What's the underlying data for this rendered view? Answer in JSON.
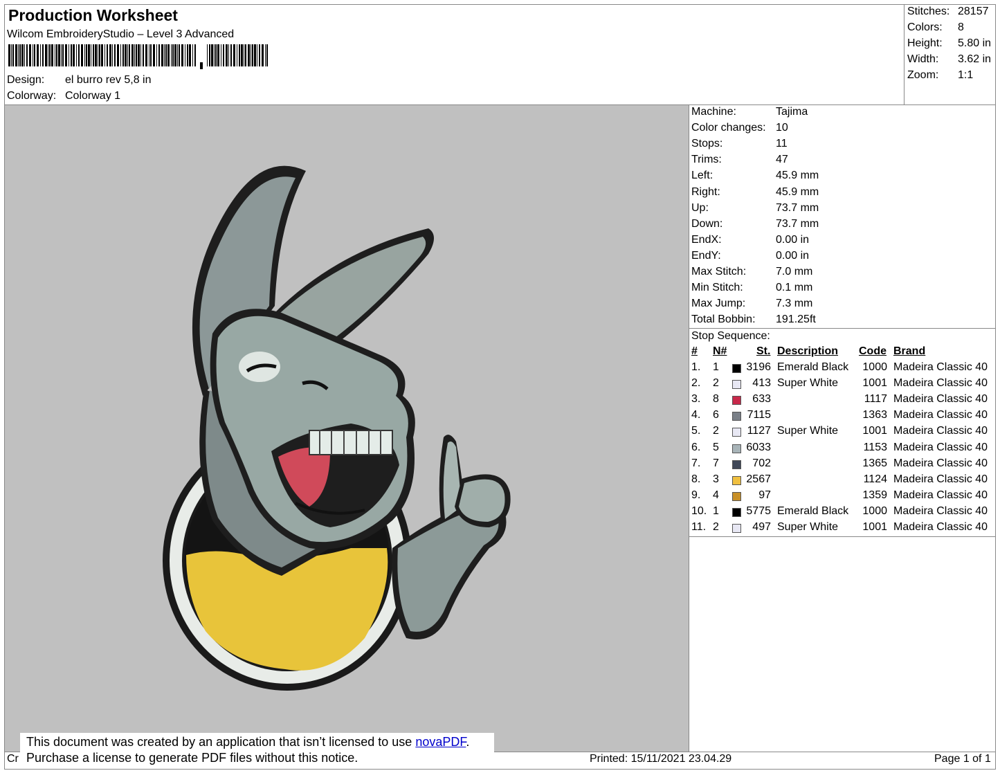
{
  "header": {
    "title": "Production Worksheet",
    "software": "Wilcom EmbroideryStudio – Level 3 Advanced",
    "design_label": "Design:",
    "design_value": "el burro rev 5,8 in",
    "colorway_label": "Colorway:",
    "colorway_value": "Colorway 1"
  },
  "stats": [
    {
      "label": "Stitches:",
      "value": "28157"
    },
    {
      "label": "Colors:",
      "value": "8"
    },
    {
      "label": "Height:",
      "value": "5.80 in"
    },
    {
      "label": "Width:",
      "value": "3.62 in"
    },
    {
      "label": "Zoom:",
      "value": "1:1"
    }
  ],
  "machine_info": [
    {
      "label": "Machine:",
      "value": "Tajima"
    },
    {
      "label": "Color changes:",
      "value": "10"
    },
    {
      "label": "Stops:",
      "value": "11"
    },
    {
      "label": "Trims:",
      "value": "47"
    },
    {
      "label": "Left:",
      "value": "45.9 mm"
    },
    {
      "label": "Right:",
      "value": "45.9 mm"
    },
    {
      "label": "Up:",
      "value": "73.7 mm"
    },
    {
      "label": "Down:",
      "value": "73.7 mm"
    },
    {
      "label": "EndX:",
      "value": "0.00 in"
    },
    {
      "label": "EndY:",
      "value": "0.00 in"
    },
    {
      "label": "Max Stitch:",
      "value": "7.0 mm"
    },
    {
      "label": "Min Stitch:",
      "value": "0.1 mm"
    },
    {
      "label": "Max Jump:",
      "value": "7.3 mm"
    },
    {
      "label": "Total Bobbin:",
      "value": "191.25ft"
    }
  ],
  "stop_sequence": {
    "title": "Stop Sequence:",
    "headers": {
      "num": "#",
      "n": "N#",
      "st": "St.",
      "desc": "Description",
      "code": "Code",
      "brand": "Brand"
    },
    "rows": [
      {
        "num": "1.",
        "n": "1",
        "color": "#000000",
        "st": "3196",
        "desc": "Emerald Black",
        "code": "1000",
        "brand": "Madeira Classic 40"
      },
      {
        "num": "2.",
        "n": "2",
        "color": "#e8e8f4",
        "st": "413",
        "desc": "Super White",
        "code": "1001",
        "brand": "Madeira Classic 40"
      },
      {
        "num": "3.",
        "n": "8",
        "color": "#c8284a",
        "st": "633",
        "desc": "",
        "code": "1117",
        "brand": "Madeira Classic 40"
      },
      {
        "num": "4.",
        "n": "6",
        "color": "#7a8088",
        "st": "7115",
        "desc": "",
        "code": "1363",
        "brand": "Madeira Classic 40"
      },
      {
        "num": "5.",
        "n": "2",
        "color": "#e8e8f4",
        "st": "1127",
        "desc": "Super White",
        "code": "1001",
        "brand": "Madeira Classic 40"
      },
      {
        "num": "6.",
        "n": "5",
        "color": "#a8b4b8",
        "st": "6033",
        "desc": "",
        "code": "1153",
        "brand": "Madeira Classic 40"
      },
      {
        "num": "7.",
        "n": "7",
        "color": "#404858",
        "st": "702",
        "desc": "",
        "code": "1365",
        "brand": "Madeira Classic 40"
      },
      {
        "num": "8.",
        "n": "3",
        "color": "#f0c040",
        "st": "2567",
        "desc": "",
        "code": "1124",
        "brand": "Madeira Classic 40"
      },
      {
        "num": "9.",
        "n": "4",
        "color": "#c89028",
        "st": "97",
        "desc": "",
        "code": "1359",
        "brand": "Madeira Classic 40"
      },
      {
        "num": "10.",
        "n": "1",
        "color": "#000000",
        "st": "5775",
        "desc": "Emerald Black",
        "code": "1000",
        "brand": "Madeira Classic 40"
      },
      {
        "num": "11.",
        "n": "2",
        "color": "#e8e8f4",
        "st": "497",
        "desc": "Super White",
        "code": "1001",
        "brand": "Madeira Classic 40"
      }
    ]
  },
  "notice": {
    "line1": "This document was created by an application that isn’t licensed to use ",
    "link": "novaPDF",
    "line1_end": ".",
    "line2": "Purchase a license to generate PDF files without this notice."
  },
  "footer": {
    "left_fragment": "Cr",
    "printed": "Printed: 15/11/2021 23.04.29",
    "page": "Page 1 of 1"
  }
}
